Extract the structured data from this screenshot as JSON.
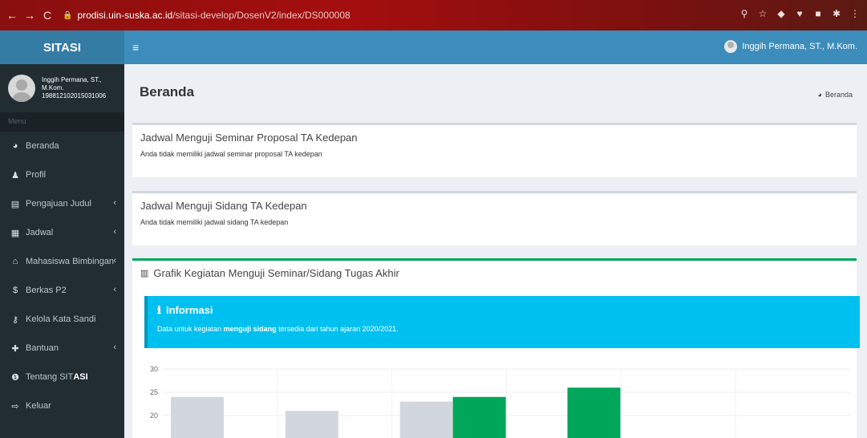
{
  "browser": {
    "url_host": "prodisi.uin-suska.ac.id",
    "url_path": "/sitasi-develop/DosenV2/index/DS000008"
  },
  "app": {
    "name": "SITASI"
  },
  "user": {
    "name": "Inggih Permana, ST., M.Kom.",
    "id": "198812102015031006"
  },
  "sidebar": {
    "header": "Menu",
    "items": [
      {
        "icon": "dashboard-icon",
        "label": "Beranda",
        "has_submenu": false
      },
      {
        "icon": "user-icon",
        "label": "Profil",
        "has_submenu": false
      },
      {
        "icon": "list-icon",
        "label": "Pengajuan Judul",
        "has_submenu": true
      },
      {
        "icon": "calendar-icon",
        "label": "Jadwal",
        "has_submenu": true
      },
      {
        "icon": "graduation-cap-icon",
        "label": "Mahasiswa Bimbingan",
        "has_submenu": true
      },
      {
        "icon": "dollar-icon",
        "label": "Berkas P2",
        "has_submenu": true
      },
      {
        "icon": "key-icon",
        "label": "Kelola Kata Sandi",
        "has_submenu": false
      },
      {
        "icon": "plus-icon",
        "label": "Bantuan",
        "has_submenu": true
      },
      {
        "icon": "info-icon",
        "label_prefix": "Tentang SIT",
        "label_bold": "ASI",
        "has_submenu": false
      },
      {
        "icon": "sign-out-icon",
        "label": "Keluar",
        "has_submenu": false
      }
    ]
  },
  "page": {
    "title": "Beranda",
    "breadcrumb": "Beranda"
  },
  "boxes": {
    "seminar": {
      "title": "Jadwal Menguji Seminar Proposal TA Kedepan",
      "body": "Anda tidak memiliki jadwal seminar proposal TA kedepan"
    },
    "sidang": {
      "title": "Jadwal Menguji Sidang TA Kedepan",
      "body": "Anda tidak memiliki jadwal sidang TA kedepan"
    },
    "chart": {
      "title": "Grafik Kegiatan Menguji Seminar/Sidang Tugas Akhir",
      "info_title": "Informasi",
      "info_prefix": "Data untuk kegiatan ",
      "info_bold": "menguji sidang",
      "info_suffix": " tersedia dari tahun ajaran 2020/2021."
    }
  },
  "colors": {
    "seminar_bar": "#d2d6de",
    "sidang_bar": "#00a65a",
    "callout": "#00c0ef",
    "header": "#3c8dbc"
  },
  "chart_data": {
    "type": "bar",
    "y_ticks": [
      20,
      25,
      30
    ],
    "series": [
      {
        "values": [
          24,
          21,
          23,
          null,
          null
        ]
      },
      {
        "values": [
          null,
          null,
          24,
          26,
          null
        ]
      }
    ]
  }
}
